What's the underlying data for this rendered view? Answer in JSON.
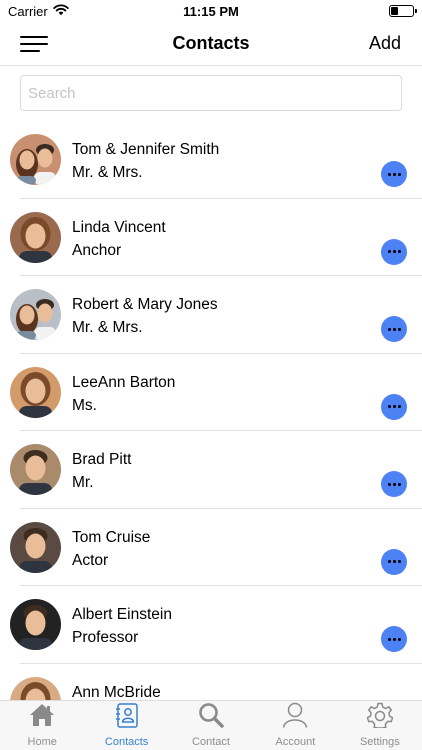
{
  "status_bar": {
    "carrier": "Carrier",
    "time": "11:15 PM",
    "battery_level": 0.35
  },
  "header": {
    "title": "Contacts",
    "add_label": "Add",
    "menu_icon": "hamburger-menu-icon"
  },
  "search": {
    "placeholder": "Search",
    "value": ""
  },
  "contacts": [
    {
      "name": "Tom & Jennifer Smith",
      "title": "Mr. & Mrs.",
      "avatar": "couple-photo",
      "bg": "#c89070"
    },
    {
      "name": "Linda Vincent",
      "title": "Anchor",
      "avatar": "woman-photo",
      "bg": "#9a6a4e"
    },
    {
      "name": "Robert & Mary Jones",
      "title": "Mr. & Mrs.",
      "avatar": "couple-photo",
      "bg": "#b9bfc6"
    },
    {
      "name": "LeeAnn Barton",
      "title": "Ms.",
      "avatar": "woman-photo",
      "bg": "#d39a6a"
    },
    {
      "name": "Brad Pitt",
      "title": "Mr.",
      "avatar": "man-photo",
      "bg": "#a98a6a"
    },
    {
      "name": "Tom Cruise",
      "title": "Actor",
      "avatar": "man-photo",
      "bg": "#5a4a42"
    },
    {
      "name": "Albert Einstein",
      "title": "Professor",
      "avatar": "man-photo",
      "bg": "#222222"
    },
    {
      "name": "Ann McBride",
      "title": "",
      "avatar": "woman-photo",
      "bg": "#d8ab84"
    }
  ],
  "tabs": [
    {
      "label": "Home",
      "icon": "house-icon",
      "active": false
    },
    {
      "label": "Contacts",
      "icon": "address-book-icon",
      "active": true
    },
    {
      "label": "Contact",
      "icon": "search-icon",
      "active": false
    },
    {
      "label": "Account",
      "icon": "user-icon",
      "active": false
    },
    {
      "label": "Settings",
      "icon": "gear-icon",
      "active": false
    }
  ],
  "colors": {
    "accent": "#3b7fd0",
    "more_button": "#4d82f5",
    "inactive_tab": "#8e8e8e",
    "tab_bar_bg": "#f7f7f7",
    "divider": "#e2e2e2"
  }
}
